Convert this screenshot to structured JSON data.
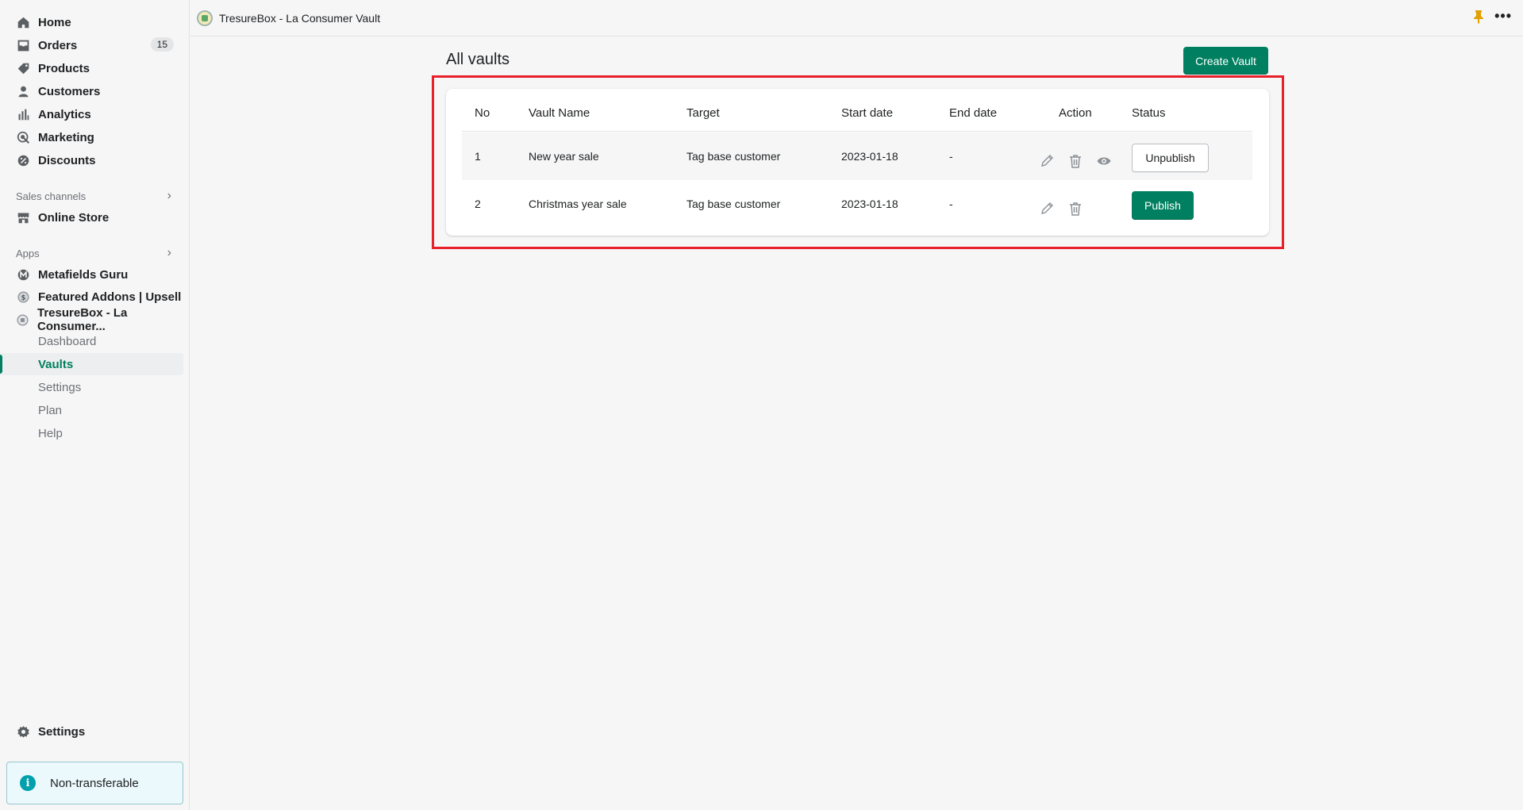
{
  "nav": {
    "home": "Home",
    "orders": "Orders",
    "orders_badge": "15",
    "products": "Products",
    "customers": "Customers",
    "analytics": "Analytics",
    "marketing": "Marketing",
    "discounts": "Discounts"
  },
  "sales_channels": {
    "label": "Sales channels",
    "online_store": "Online Store"
  },
  "apps": {
    "label": "Apps",
    "metafields": "Metafields Guru",
    "featured": "Featured Addons | Upsell",
    "tresurebox": "TresureBox - La Consumer...",
    "sub": {
      "dashboard": "Dashboard",
      "vaults": "Vaults",
      "settings": "Settings",
      "plan": "Plan",
      "help": "Help"
    }
  },
  "settings_label": "Settings",
  "notice": {
    "icon": "info-icon",
    "text": "Non-transferable"
  },
  "topbar": {
    "app_title": "TresureBox - La Consumer Vault"
  },
  "main": {
    "title": "All vaults",
    "create_button": "Create Vault",
    "columns": {
      "no": "No",
      "name": "Vault Name",
      "target": "Target",
      "start": "Start date",
      "end": "End date",
      "action": "Action",
      "status": "Status"
    },
    "rows": [
      {
        "no": "1",
        "name": "New year sale",
        "target": "Tag base customer",
        "start": "2023-01-18",
        "end": "-",
        "status_button": "Unpublish"
      },
      {
        "no": "2",
        "name": "Christmas year sale",
        "target": "Tag base customer",
        "start": "2023-01-18",
        "end": "-",
        "status_button": "Publish"
      }
    ]
  },
  "colors": {
    "accent": "#008060",
    "highlight": "#e8202a",
    "active_text": "#007f5f"
  }
}
